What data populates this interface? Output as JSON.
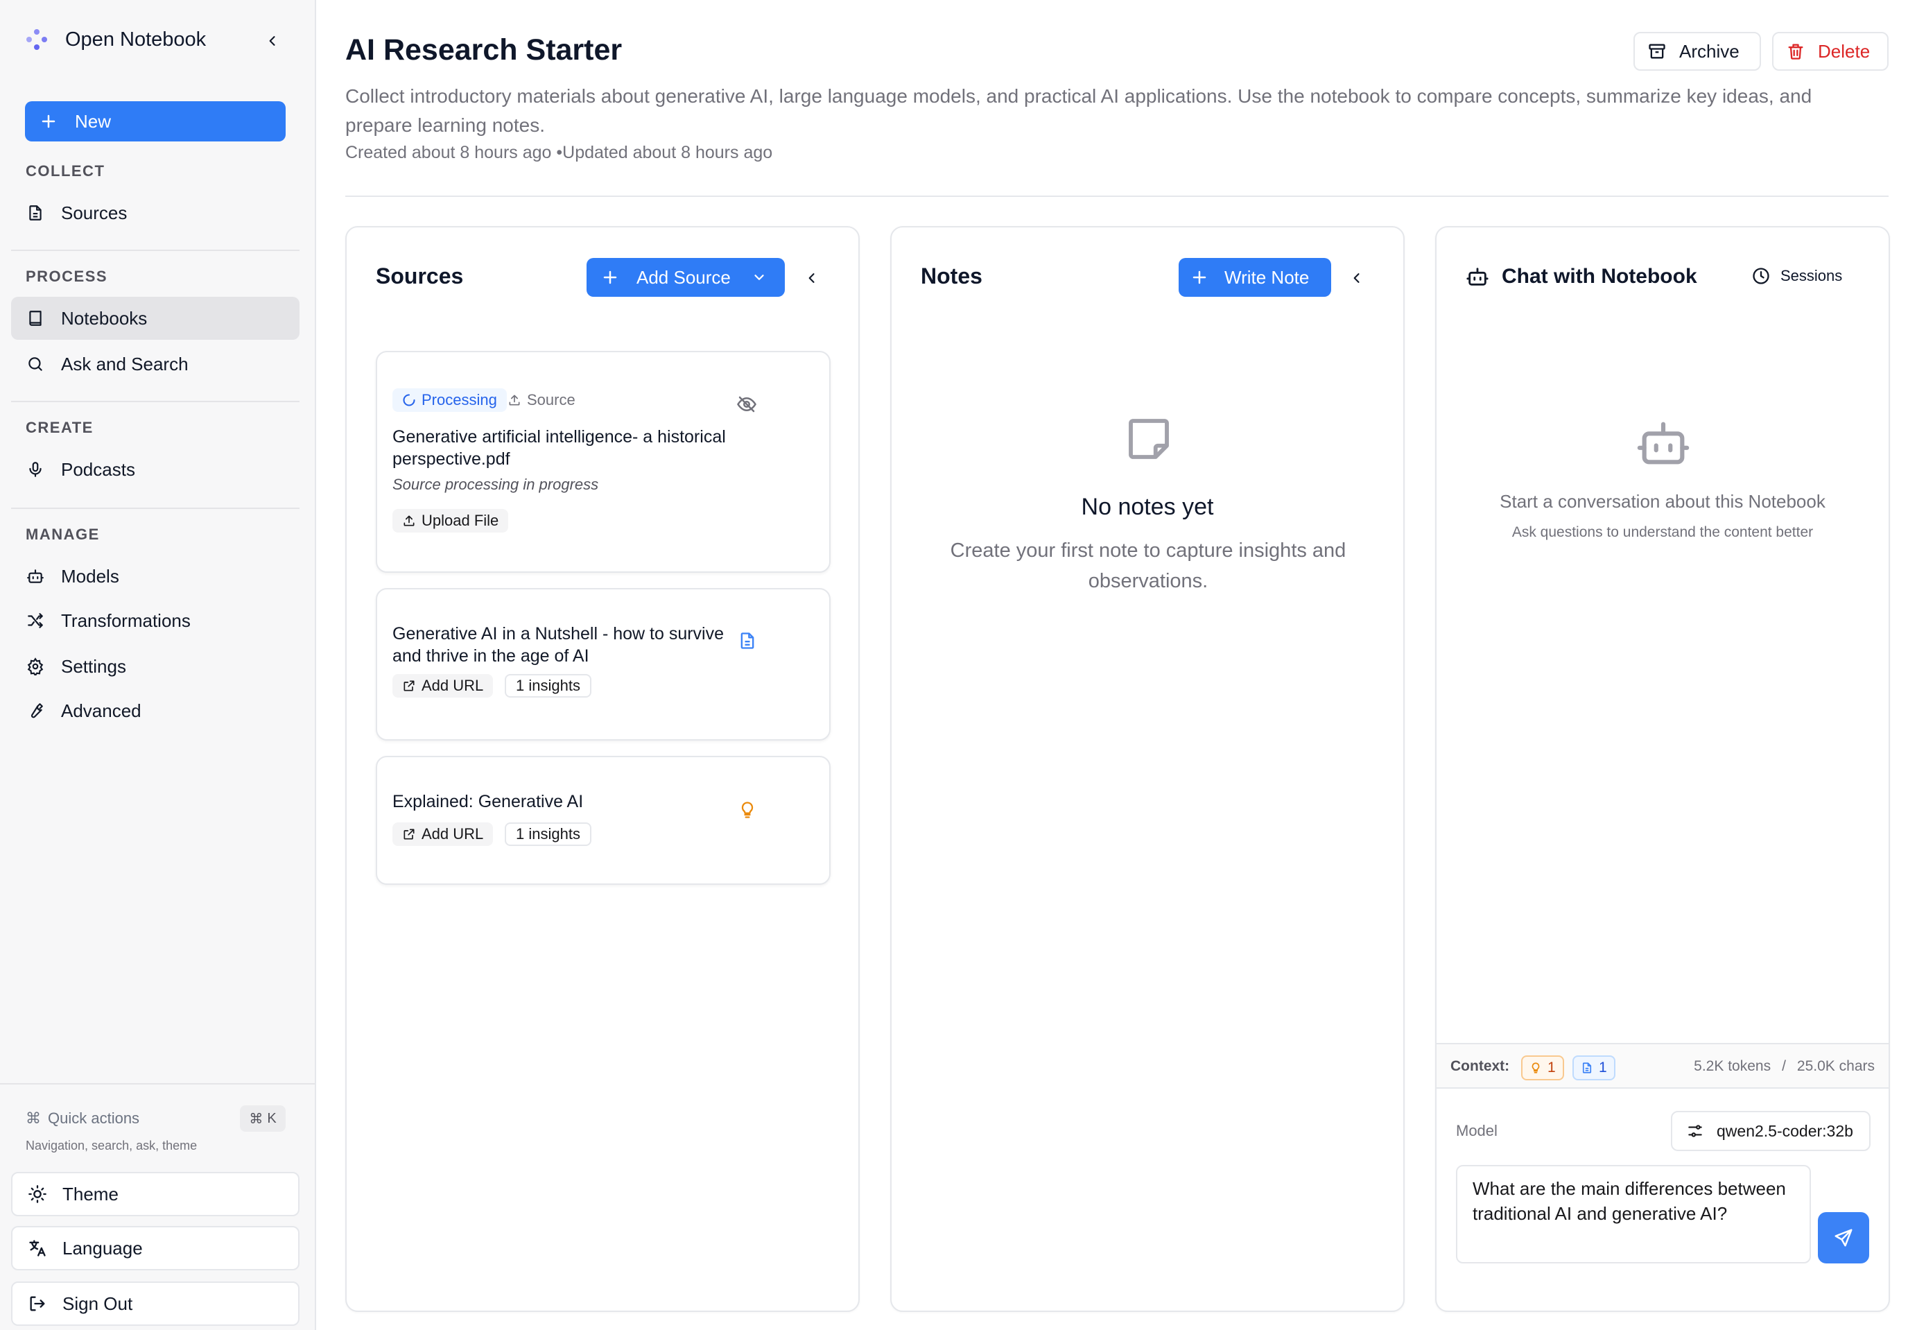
{
  "app": {
    "title": "Open Notebook"
  },
  "sidebar": {
    "new_label": "New",
    "sections": {
      "collect": "COLLECT",
      "process": "PROCESS",
      "create": "CREATE",
      "manage": "MANAGE"
    },
    "items": {
      "sources": "Sources",
      "notebooks": "Notebooks",
      "ask_search": "Ask and Search",
      "podcasts": "Podcasts",
      "models": "Models",
      "transformations": "Transformations",
      "settings": "Settings",
      "advanced": "Advanced"
    },
    "quick_actions": {
      "label": "Quick actions",
      "shortcut": "K",
      "subtitle": "Navigation, search, ask, theme"
    },
    "bottom": {
      "theme": "Theme",
      "language": "Language",
      "sign_out": "Sign Out"
    }
  },
  "notebook": {
    "title": "AI Research Starter",
    "description": "Collect introductory materials about generative AI, large language models, and practical AI applications. Use the notebook to compare concepts, summarize key ideas, and prepare learning notes.",
    "meta": "Created about 8 hours ago •Updated about 8 hours ago",
    "archive_label": "Archive",
    "delete_label": "Delete"
  },
  "sources_panel": {
    "title": "Sources",
    "add_label": "Add Source",
    "cards": [
      {
        "status": "Processing",
        "type_label": "Source",
        "title": "Generative artificial intelligence- a historical perspective.pdf",
        "note": "Source processing in progress",
        "action": "Upload File"
      },
      {
        "title": "Generative AI in a Nutshell - how to survive and thrive in the age of AI",
        "action": "Add URL",
        "insights": "1 insights"
      },
      {
        "title": "Explained: Generative AI",
        "action": "Add URL",
        "insights": "1 insights"
      }
    ]
  },
  "notes_panel": {
    "title": "Notes",
    "write_label": "Write Note",
    "empty_title": "No notes yet",
    "empty_desc": "Create your first note to capture insights and observations."
  },
  "chat_panel": {
    "title": "Chat with Notebook",
    "sessions_label": "Sessions",
    "empty_title": "Start a conversation about this Notebook",
    "empty_desc": "Ask questions to understand the content better",
    "context_label": "Context:",
    "insight_count": "1",
    "source_count": "1",
    "tokens": "5.2K tokens",
    "separator": "/",
    "chars": "25.0K chars",
    "model_label": "Model",
    "model_value": "qwen2.5-coder:32b",
    "input_value": "What are the main differences between traditional AI and generative AI?"
  },
  "colors": {
    "accent": "#2f7cf6",
    "danger": "#dc2626",
    "warning": "#ea8a0c"
  }
}
